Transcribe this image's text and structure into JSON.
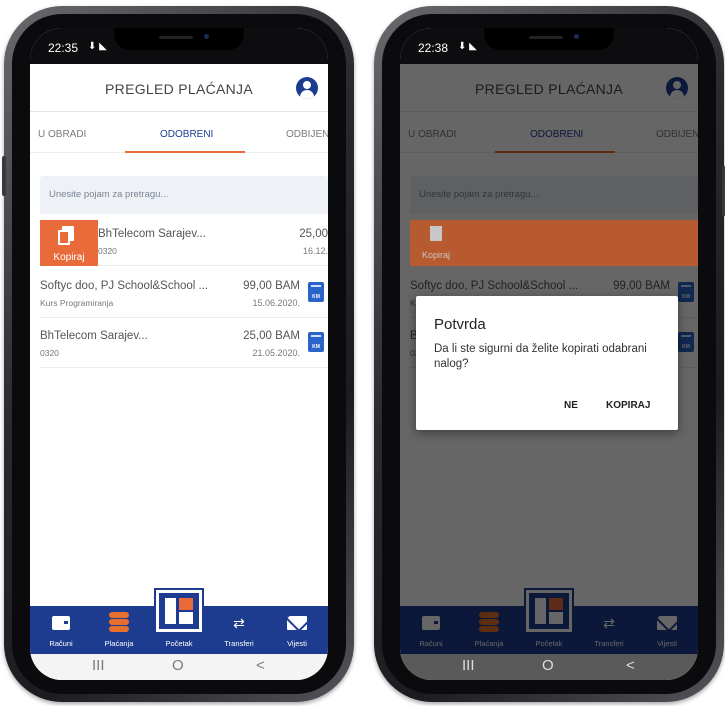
{
  "statusbar_left": {
    "time": "22:35"
  },
  "statusbar_right": {
    "time": "22:38"
  },
  "header": {
    "title": "PREGLED PLAĆANJA"
  },
  "tabs": [
    {
      "label": "U OBRADI"
    },
    {
      "label": "ODOBRENI"
    },
    {
      "label": "ODBIJENI"
    }
  ],
  "search": {
    "placeholder": "Unesite pojam za pretragu..."
  },
  "payments": [
    {
      "name": "BhTelecom Sarajev...",
      "sub": "0320",
      "amount": "25,00",
      "date": "16.12."
    },
    {
      "name": "Softyc doo,  PJ School&School ...",
      "sub": "Kurs Programiranja",
      "amount": "99,00 BAM",
      "date": "15.06.2020."
    },
    {
      "name": "BhTelecom Sarajev...",
      "sub": "0320",
      "amount": "25,00 BAM",
      "date": "21.05.2020."
    }
  ],
  "copy_action": {
    "label": "Kopiraj"
  },
  "doc_icon_label": "KM",
  "bottom_nav": [
    {
      "label": "Računi"
    },
    {
      "label": "Plaćanja"
    },
    {
      "label": "Početak"
    },
    {
      "label": "Transferi"
    },
    {
      "label": "Vijesti"
    }
  ],
  "system_nav": {
    "recent": "III",
    "home": "O",
    "back": "<"
  },
  "dialog": {
    "title": "Potvrda",
    "message": "Da li ste sigurni da želite kopirati odabrani nalog?",
    "cancel": "NE",
    "confirm": "KOPIRAJ"
  },
  "colors": {
    "brand_blue": "#1e3c8f",
    "accent_orange": "#ea6b3a"
  }
}
